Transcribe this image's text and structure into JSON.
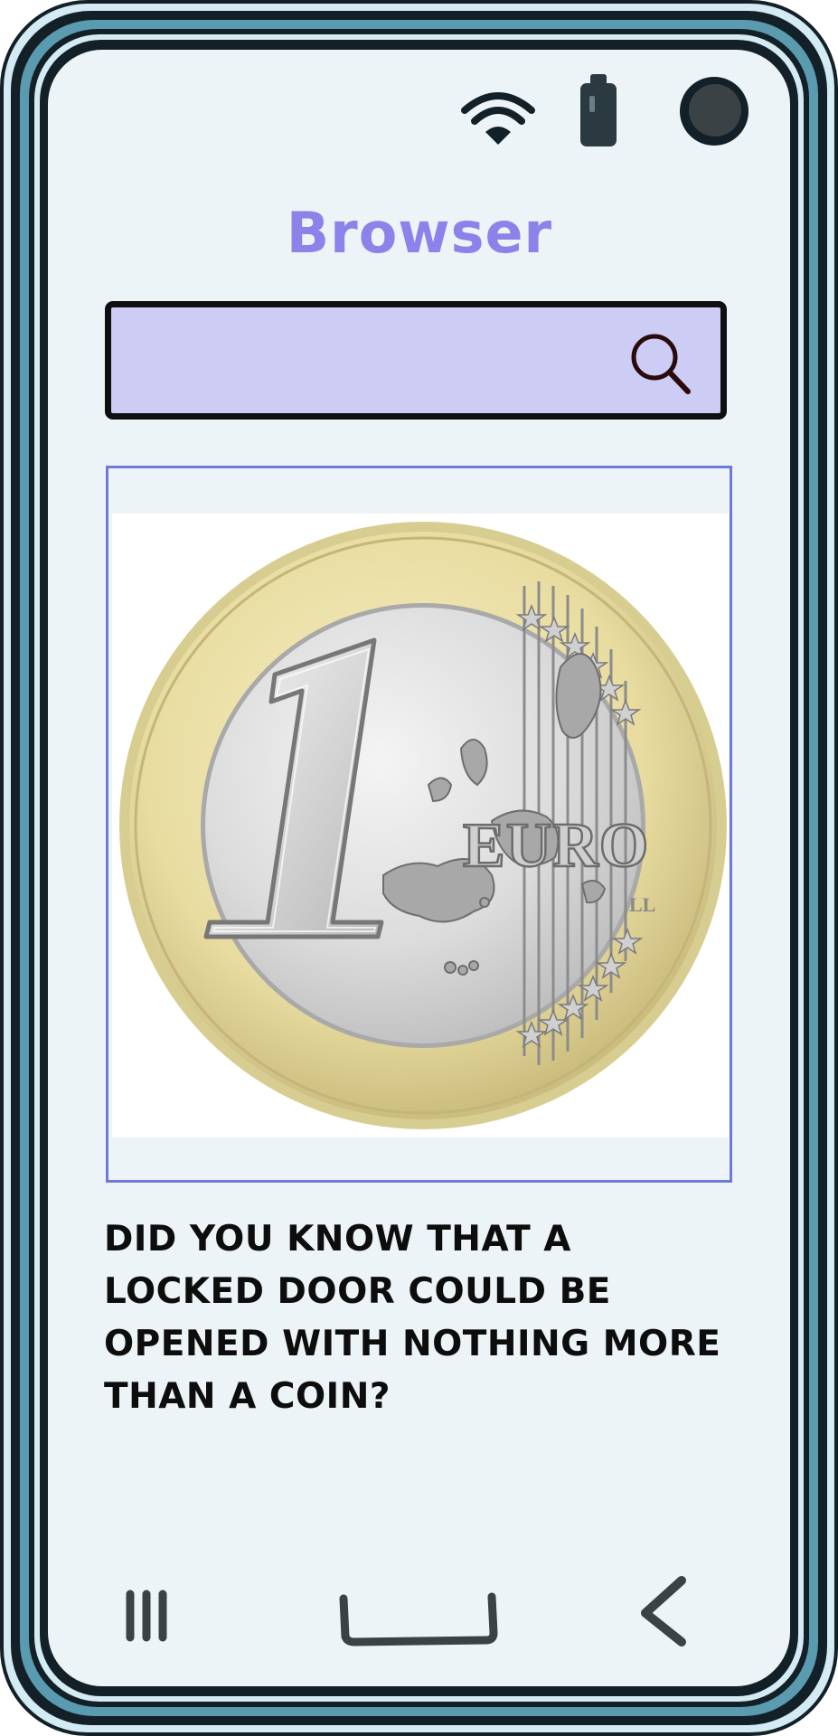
{
  "app": {
    "title": "Browser"
  },
  "status_bar": {
    "icons": [
      "wifi-icon",
      "battery-icon",
      "camera-icon"
    ]
  },
  "search": {
    "value": "",
    "placeholder": "",
    "icon": "search-icon"
  },
  "result": {
    "image": {
      "denomination": "1",
      "currency_label": "EURO",
      "engraver_initials": "LL"
    },
    "text": "Did you know that a locked door could be opened with nothing more than a coin?"
  },
  "nav_bar": {
    "icons": [
      "recent-apps-icon",
      "home-icon",
      "back-icon"
    ]
  },
  "colors": {
    "screen_bg": "#edf4f7",
    "frame_outer": "#132027",
    "frame_accent": "#5a9bb0",
    "title": "#8b82ea",
    "search_bg": "#ccccf4",
    "card_border": "#6f78d6",
    "text": "#0d0d0d"
  }
}
